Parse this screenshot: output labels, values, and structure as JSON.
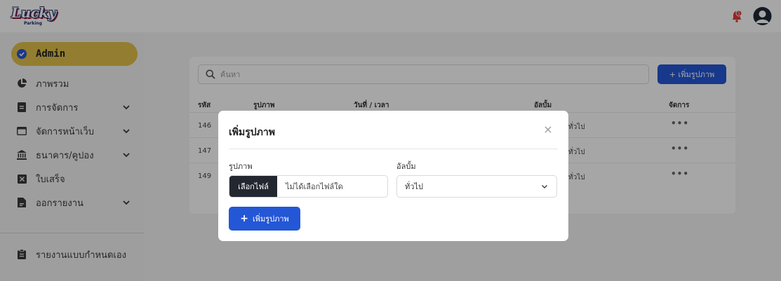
{
  "header": {
    "logo_text": "Lucky",
    "logo_sub": "Parking",
    "notification_count": "1"
  },
  "sidebar": {
    "items": [
      {
        "label": "Admin",
        "icon": "check-badge-icon"
      },
      {
        "label": "ภาพรวม",
        "icon": "pie-chart-icon"
      },
      {
        "label": "การจัดการ",
        "icon": "document-icon"
      },
      {
        "label": "จัดการหน้าเว็บ",
        "icon": "browser-window-icon"
      },
      {
        "label": "ธนาคาร/คูปอง",
        "icon": "bank-icon"
      },
      {
        "label": "ใบเสร็จ",
        "icon": "receipt-icon"
      },
      {
        "label": "ออกรายงาน",
        "icon": "report-file-icon"
      },
      {
        "label": "รายงานแบบกำหนดเอง",
        "icon": "clipboard-icon"
      }
    ]
  },
  "main": {
    "search_placeholder": "ค้นหา",
    "add_button": "+ เพิ่มรูปภาพ",
    "table": {
      "headers": [
        "รหัส",
        "รูปภาพ",
        "วันที่ / เวลา",
        "อัลบั้ม",
        "จัดการ"
      ],
      "rows": [
        {
          "id": "146",
          "album": "ทั่วไป",
          "actions": "•••"
        },
        {
          "id": "147",
          "album": "ทั่วไป",
          "actions": "•••"
        },
        {
          "id": "149",
          "album": "ทั่วไป",
          "actions": "•••"
        }
      ]
    }
  },
  "modal": {
    "title": "เพิ่มรูปภาพ",
    "close": "×",
    "image_label": "รูปภาพ",
    "file_button": "เลือกไฟล์",
    "file_status": "ไม่ได้เลือกไฟล์ใด",
    "album_label": "อัลบั้ม",
    "album_selected": "ทั่วไป",
    "submit_plus": "+",
    "submit_label": "เพิ่มรูปภาพ"
  },
  "colors": {
    "accent_blue": "#2457d6",
    "active_yellow": "#e2c04a",
    "file_button_dark": "#23272f",
    "notification_red": "#e53935"
  }
}
